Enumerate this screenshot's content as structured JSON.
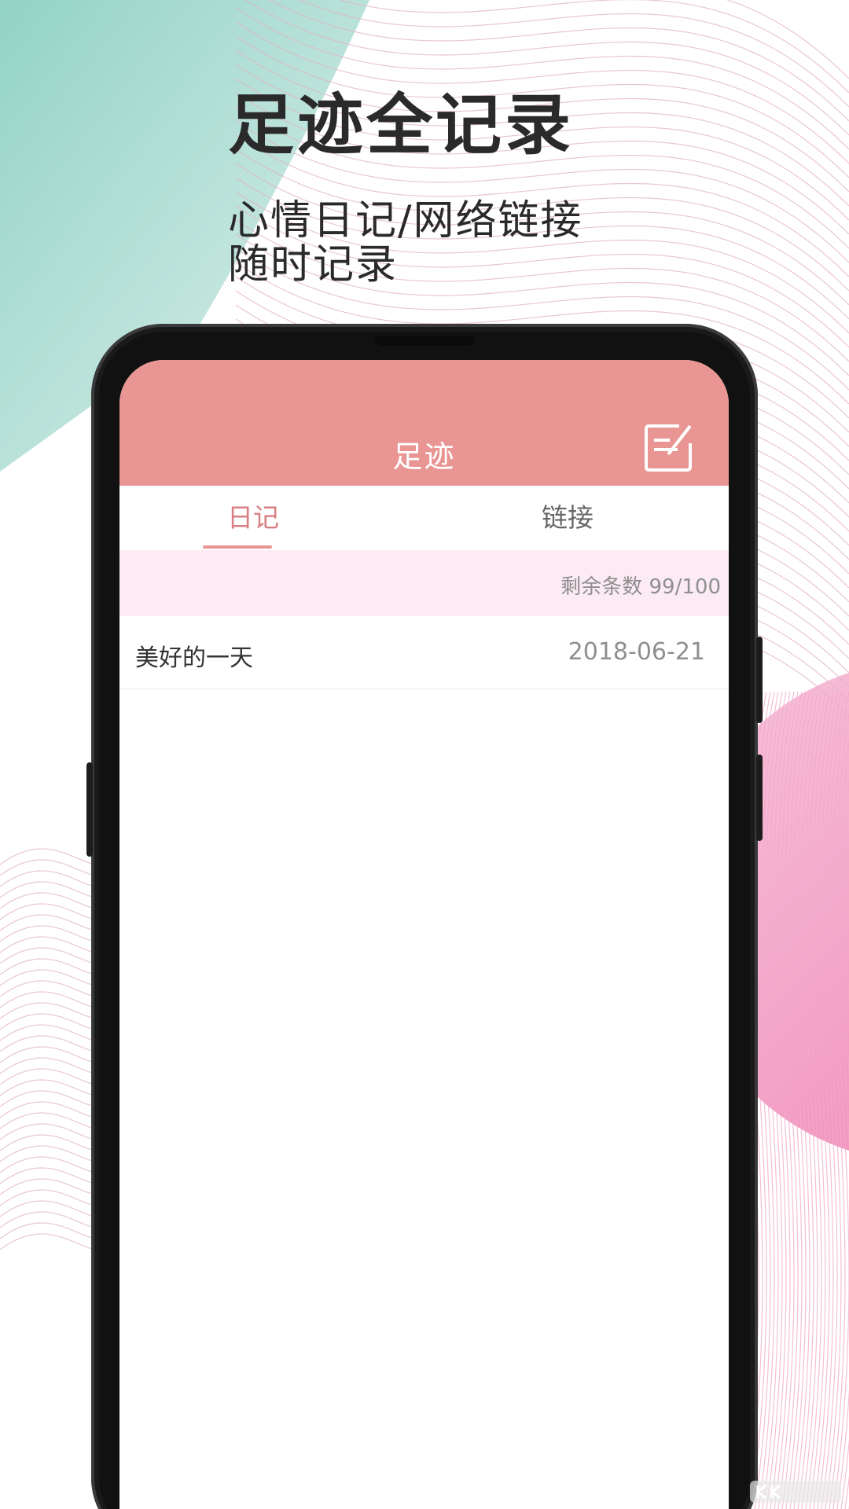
{
  "promo": {
    "headline": "足迹全记录",
    "subline_1": "心情日记/网络链接",
    "subline_2": "随时记录"
  },
  "app": {
    "title": "足迹",
    "edit_icon": "edit-note-icon",
    "tabs": [
      {
        "label": "日记",
        "selected": true
      },
      {
        "label": "链接",
        "selected": false
      }
    ],
    "remaining_label": "剩余条数 99/100",
    "entries": [
      {
        "title": "美好的一天",
        "date": "2018-06-21"
      }
    ]
  },
  "colors": {
    "accent": "#e99593",
    "tab_selected": "#d97f83",
    "count_bar_bg": "#fcebf4",
    "bg_teal": "#9fd7cc",
    "bg_pink": "#f08ab8"
  }
}
